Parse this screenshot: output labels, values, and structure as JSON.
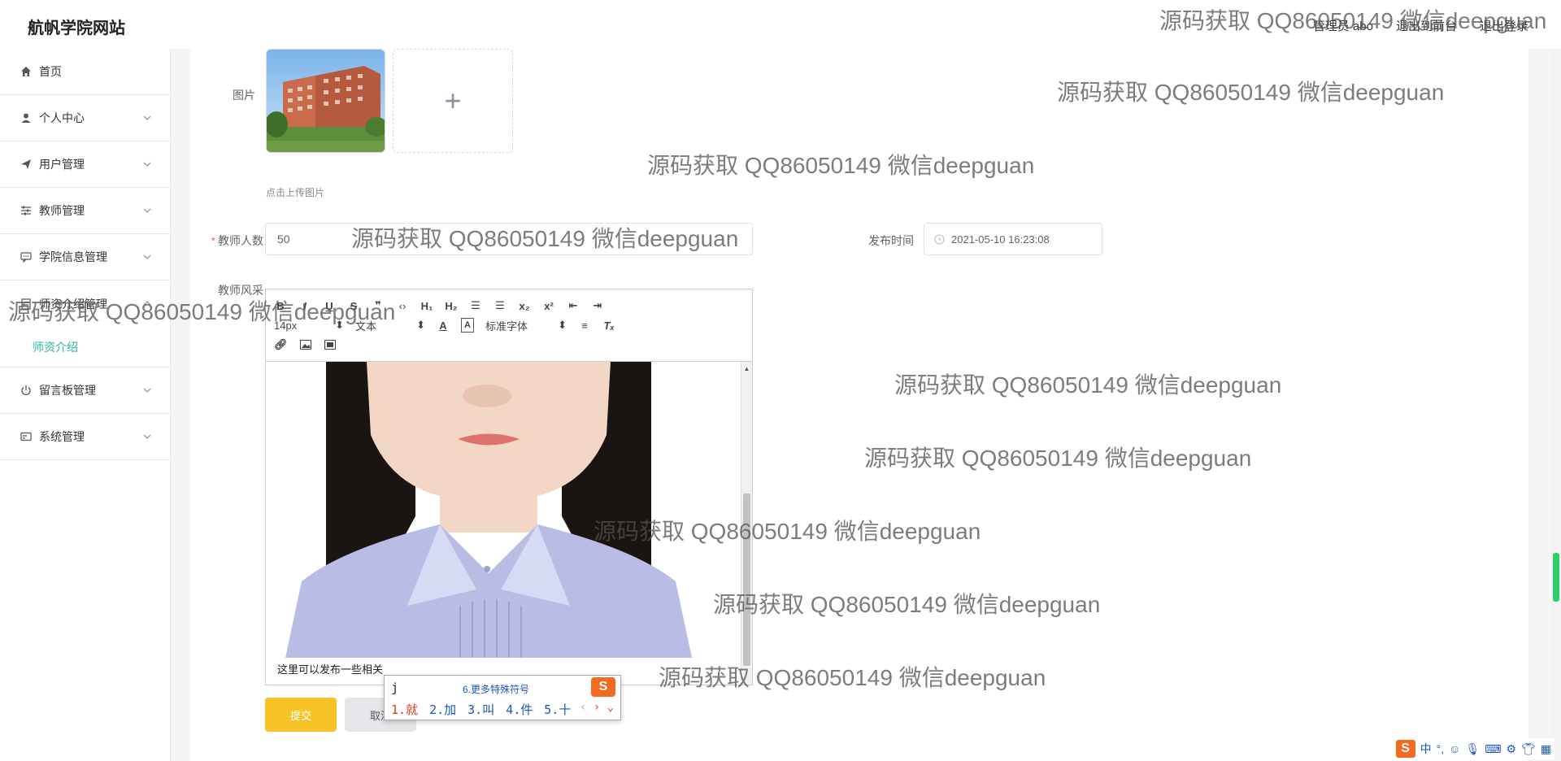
{
  "header": {
    "site_title": "航帆学院网站",
    "admin_label": "管理员 abo",
    "back_front_label": "退出到前台",
    "logout_label": "退出登录"
  },
  "sidebar": {
    "items": [
      {
        "label": "首页",
        "icon": "home-icon"
      },
      {
        "label": "个人中心",
        "icon": "user-icon"
      },
      {
        "label": "用户管理",
        "icon": "send-icon"
      },
      {
        "label": "教师管理",
        "icon": "sliders-icon"
      },
      {
        "label": "学院信息管理",
        "icon": "chat-icon"
      },
      {
        "label": "师资介绍管理",
        "icon": "doc-icon"
      },
      {
        "label": "留言板管理",
        "icon": "power-icon"
      },
      {
        "label": "系统管理",
        "icon": "card-icon"
      }
    ],
    "submenu": {
      "label": "师资介绍"
    }
  },
  "form": {
    "image_label": "图片",
    "upload_tip": "点击上传图片",
    "upload_plus": "+",
    "teacher_count_label": "教师人数",
    "teacher_count_value": "50",
    "publish_time_label": "发布时间",
    "publish_time_value": "2021-05-10 16:23:08",
    "teacher_style_label": "教师风采",
    "submit_label": "提交",
    "cancel_label": "取消"
  },
  "editor": {
    "font_size": "14px",
    "paragraph": "文本",
    "font_family": "标准字体",
    "content_text": "这里可以发布一些相关"
  },
  "ime": {
    "input": "j",
    "more_symbols": "6.更多特殊符号",
    "candidates": [
      "1.就",
      "2.加",
      "3.叫",
      "4.件",
      "5.十"
    ]
  },
  "tray": {
    "lang": "中"
  },
  "watermark_text": "源码获取 QQ86050149 微信deepguan",
  "colors": {
    "accent": "#2bb3a0",
    "submit": "#f7c326",
    "required": "#f56c6c"
  }
}
